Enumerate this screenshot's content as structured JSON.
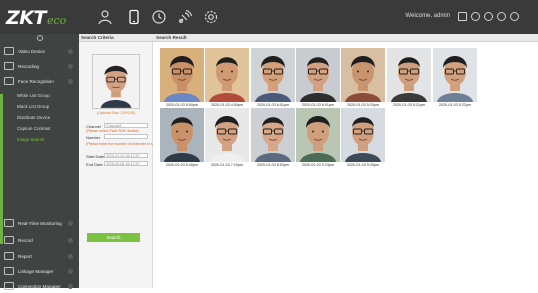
{
  "header": {
    "logo_main": "ZKT",
    "logo_sub": "eco",
    "welcome": "Welcome, admin",
    "nav_icons": [
      "person-icon",
      "phone-icon",
      "clock-icon",
      "satellite-icon",
      "gear-icon"
    ]
  },
  "sidebar": {
    "items": [
      {
        "label": "Video Device"
      },
      {
        "label": "Recording"
      },
      {
        "label": "Face Recognition"
      }
    ],
    "sub_items": [
      {
        "label": "White List Group"
      },
      {
        "label": "Black List Group"
      },
      {
        "label": "Distribute Device"
      },
      {
        "label": "Capture Contrast"
      },
      {
        "label": "Image Search"
      }
    ],
    "bottom_items": [
      {
        "label": "Real-Time Monitoring"
      },
      {
        "label": "Record"
      },
      {
        "label": "Report"
      },
      {
        "label": "Linkage Manager"
      },
      {
        "label": "Connection Manager"
      }
    ]
  },
  "criteria": {
    "title": "Search Criteria",
    "photo_caption": "(Optimal Size: 120*140)",
    "channel_label": "Channel",
    "channel_value": "Channel3",
    "hint1": "(Please select Face SDK device)",
    "number_label": "Number",
    "hint2": "(Please enter the number of channels to search)",
    "start_label": "Start Date",
    "start_value": "2020-01-29 16:47:20",
    "end_label": "End Date",
    "end_value": "2020-02-05 16:47:20",
    "search_button": "Search"
  },
  "results": {
    "title": "Search Result",
    "items": [
      {
        "time": "2020-01-03 5:00pm",
        "skin": "#c98f66",
        "bg": "#d8b07c",
        "shirt": "#6b87c4"
      },
      {
        "time": "2020-01-03 4:00pm",
        "skin": "#d09b72",
        "bg": "#e2c49a",
        "shirt": "#b24b3c"
      },
      {
        "time": "2020-01-03 6:01pm",
        "skin": "#d4a07a",
        "bg": "#cfd3d6",
        "shirt": "#4c5a7a"
      },
      {
        "time": "2020-01-03 6:01pm",
        "skin": "#d3a181",
        "bg": "#c8ccd0",
        "shirt": "#2d2d2d"
      },
      {
        "time": "2020-01-03 5:20pm",
        "skin": "#c8956e",
        "bg": "#d9bfa2",
        "shirt": "#8a4b3a"
      },
      {
        "time": "2020-01-03 5:21pm",
        "skin": "#cf9f7c",
        "bg": "#e3e4e6",
        "shirt": "#3b3b3b"
      },
      {
        "time": "2020-01-03 5:22pm",
        "skin": "#d1a07d",
        "bg": "#dfe3e8",
        "shirt": "#6f7f96"
      },
      {
        "time": "2020-01-03 6:40pm",
        "skin": "#c9926b",
        "bg": "#a9b4bc",
        "shirt": "#2f3a48"
      },
      {
        "time": "2020-01-03 7:10pm",
        "skin": "#d3a283",
        "bg": "#e8e8e8",
        "shirt": "#efefef"
      },
      {
        "time": "2020-01-03 8:03pm",
        "skin": "#d6a889",
        "bg": "#cccfd3",
        "shirt": "#5b6b7f"
      },
      {
        "time": "2020-01-03 9:23pm",
        "skin": "#cf9e7c",
        "bg": "#b9c6b3",
        "shirt": "#4d6b57"
      },
      {
        "time": "2020-01-03 9:25pm",
        "skin": "#d1a080",
        "bg": "#d5dbe0",
        "shirt": "#3e4a5a"
      }
    ]
  },
  "colors": {
    "accent": "#7cc242",
    "header_bg": "#3a3a3a",
    "sidebar_bg": "#3f4341"
  }
}
